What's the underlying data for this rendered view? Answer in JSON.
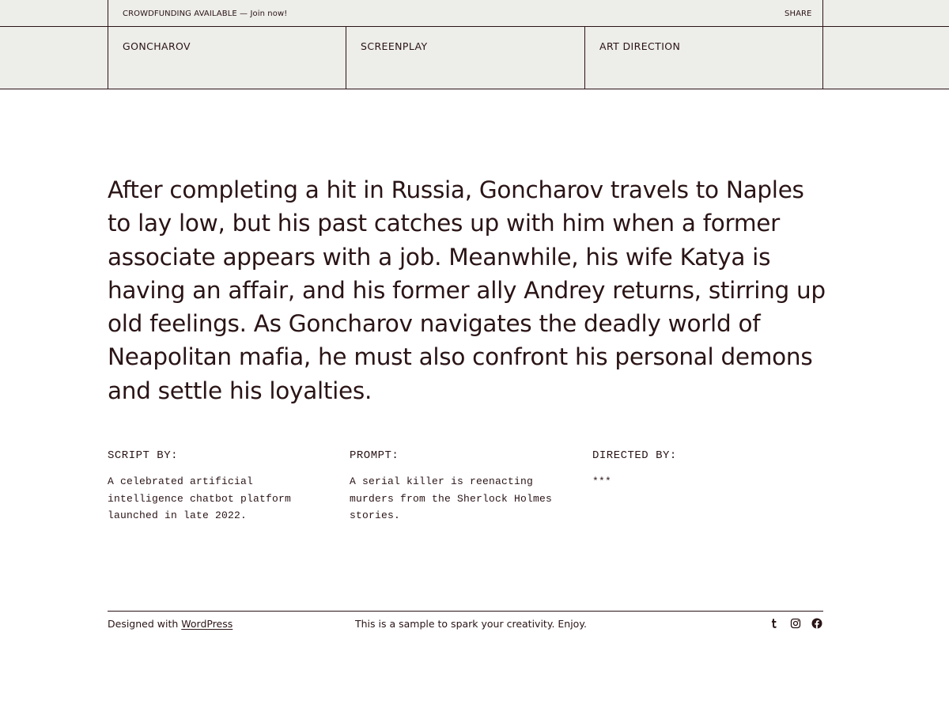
{
  "topbar": {
    "announcement": "CROWDFUNDING AVAILABLE — Join now!",
    "share_label": "SHARE"
  },
  "nav": {
    "items": [
      {
        "label": "GONCHAROV"
      },
      {
        "label": "SCREENPLAY"
      },
      {
        "label": "ART DIRECTION"
      }
    ]
  },
  "synopsis": "After completing a hit in Russia, Goncharov travels to Naples to lay low, but his past catches up with him when a former associate appears with a job. Meanwhile, his wife Katya is having an affair, and his former ally Andrey returns, stirring up old feelings. As Goncharov navigates the deadly world of Neapolitan mafia, he must also confront his personal demons and settle his loyalties.",
  "credits": [
    {
      "heading": "SCRIPT BY:",
      "text": "A celebrated artificial intelligence chatbot platform launched in late 2022."
    },
    {
      "heading": "PROMPT:",
      "text": "A serial killer is reenacting murders from the Sherlock Holmes stories."
    },
    {
      "heading": "DIRECTED BY:",
      "text": "***"
    }
  ],
  "footer": {
    "designed_prefix": "Designed with ",
    "designed_link": "WordPress",
    "tagline": "This is a sample to spark your creativity. Enjoy.",
    "social": [
      {
        "icon": "tumblr-icon"
      },
      {
        "icon": "instagram-icon"
      },
      {
        "icon": "facebook-icon"
      }
    ]
  },
  "colors": {
    "header_background": "#ededea",
    "text": "#2a1416",
    "page_background": "#ffffff"
  }
}
